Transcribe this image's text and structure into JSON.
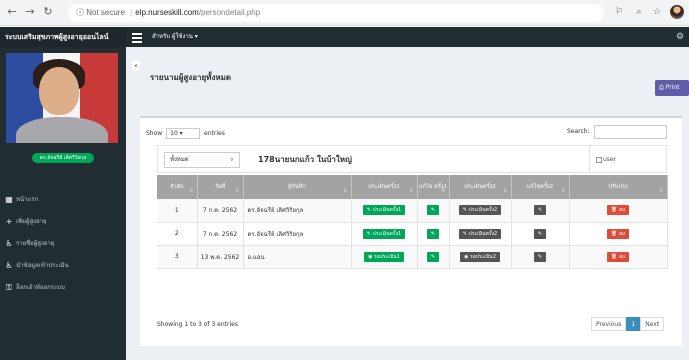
{
  "browser": {
    "not_secure": "Not secure",
    "host": "elp.nurseskill.com",
    "path": "/persondetail.php"
  },
  "app": {
    "title": "ระบบเสริมสุขภาพผู้สูงอายุออนไลน์",
    "user_menu": "สำหรับ ผู้ใช้งาน ▾"
  },
  "sidebar": {
    "user_name": "ดร.อัจฉรีย์ เลิศวิริยกุล",
    "items": [
      {
        "icon": "dashboard-icon",
        "glyph": "▦",
        "label": "หน้าแรก"
      },
      {
        "icon": "add-user-icon",
        "glyph": "+",
        "label": "เพิ่มผู้สูงอายุ"
      },
      {
        "icon": "elderly-list-icon",
        "glyph": "♿",
        "label": "รายชื่อผู้สูงอายุ"
      },
      {
        "icon": "assessment-icon",
        "glyph": "♿",
        "label": "นำข้อมูลเข้าประเมิน"
      },
      {
        "icon": "logout-icon",
        "glyph": "⚿",
        "label": "ล็อกเอ้าท์ออกระบบ"
      }
    ]
  },
  "main": {
    "page_title": "รายนามผู้สูงอายุทั้งหมด",
    "print_label": "Print",
    "show_label": "Show",
    "entries_value": "10",
    "entries_label": "entries",
    "search_label": "Search:",
    "site_select_value": "ทั้งหมด",
    "hospital_name": "178นายนกแก้ว ในบ้าใหญ่",
    "user_image_alt": "user"
  },
  "table": {
    "columns": [
      "ลำดับ",
      "วันที่",
      "ผู้บันทึก",
      "ประเมินครั้ง1",
      "แก้ไข ครั้ง1",
      "ประเมินครั้ง2",
      "แก้ไขครั้ง2",
      "ปรับปรุง"
    ],
    "rows": [
      {
        "no": "1",
        "date": "7 ก.ค. 2562",
        "recorder": "ดร.อัจฉรีย์ เลิศวิริยกุล",
        "eval1": "ประเมินครั้ง1",
        "eval1_state": "edit",
        "eval2": "ประเมินครั้ง2",
        "eval2_state": "edit",
        "delete": "ลบ"
      },
      {
        "no": "2",
        "date": "7 ก.ค. 2562",
        "recorder": "ดร.อัจฉรีย์ เลิศวิริยกุล",
        "eval1": "ประเมินครั้ง1",
        "eval1_state": "edit",
        "eval2": "ประเมินครั้ง2",
        "eval2_state": "edit",
        "delete": "ลบ"
      },
      {
        "no": "3",
        "date": "13 พ.ค. 2562",
        "recorder": "อ.แอน",
        "eval1": "รอประเมิน1",
        "eval1_state": "pending",
        "eval2": "รอประเมิน2",
        "eval2_state": "pending",
        "delete": "ลบ"
      }
    ]
  },
  "footer": {
    "info": "Showing 1 to 3 of 3 entries",
    "previous": "Previous",
    "page": "1",
    "next": "Next"
  },
  "colors": {
    "sidebar_bg": "#222d32",
    "success": "#00a65a",
    "danger": "#dd4b39",
    "print_purple": "#605ca8",
    "pager_active": "#3c8dbc"
  }
}
